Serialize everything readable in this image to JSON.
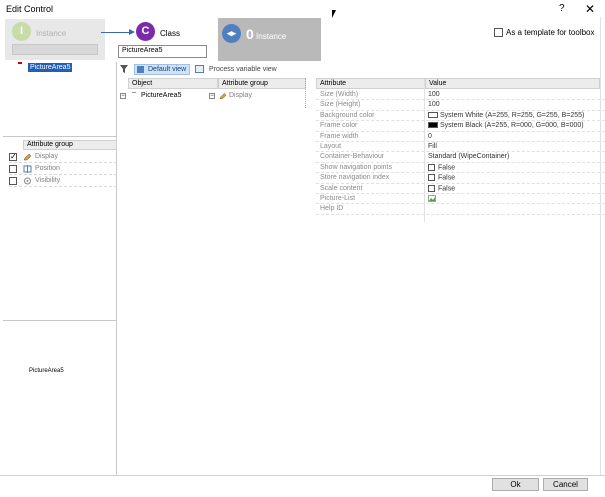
{
  "window": {
    "title": "Edit Control",
    "help_label": "?",
    "close_label": "✕"
  },
  "wizard": {
    "instance_letter": "I",
    "instance_label": "Instance",
    "class_letter": "C",
    "class_label": "Class",
    "class_input_value": "PictureArea5",
    "ninstance_count": "0",
    "ninstance_label": "Instance",
    "template_label": "As a template for toolbox"
  },
  "left": {
    "root_item": "PictureArea5",
    "attribute_group_header": "Attribute group",
    "attribute_groups": [
      {
        "label": "Display",
        "checked": true
      },
      {
        "label": "Position",
        "checked": false
      },
      {
        "label": "Visibility",
        "checked": false
      }
    ],
    "preview_label": "PictureArea5"
  },
  "toolbar": {
    "default_view_label": "Default view",
    "process_view_label": "Process variable view"
  },
  "object_grid": {
    "object_header": "Object",
    "object_item": "PictureArea5",
    "group_header": "Attribute group",
    "group_item": "Display"
  },
  "attributes": {
    "name_header": "Attribute",
    "value_header": "Value",
    "rows": [
      {
        "name": "Size (Width)",
        "value": "100"
      },
      {
        "name": "Size (Height)",
        "value": "100"
      },
      {
        "name": "Background color",
        "value": "System White (A=255, R=255, G=255, B=255)"
      },
      {
        "name": "Frame color",
        "value": "System Black (A=255, R=000, G=000, B=000)"
      },
      {
        "name": "Frame width",
        "value": "0"
      },
      {
        "name": "Layout",
        "value": "Fill"
      },
      {
        "name": "Container-Behaviour",
        "value": "Standard (WipeContainer)"
      },
      {
        "name": "Show navigation points",
        "value": "False"
      },
      {
        "name": "Store navigation index",
        "value": "False"
      },
      {
        "name": "Scale content",
        "value": "False"
      },
      {
        "name": "Picture-List",
        "value": ""
      },
      {
        "name": "Help ID",
        "value": ""
      }
    ]
  },
  "footer": {
    "ok_label": "Ok",
    "cancel_label": "Cancel"
  },
  "colors": {
    "accent": "#1f5fb6",
    "class_circle": "#7b2aa8",
    "instance_circle": "#c6dca9",
    "ninstance_circle": "#4f7fbe"
  }
}
